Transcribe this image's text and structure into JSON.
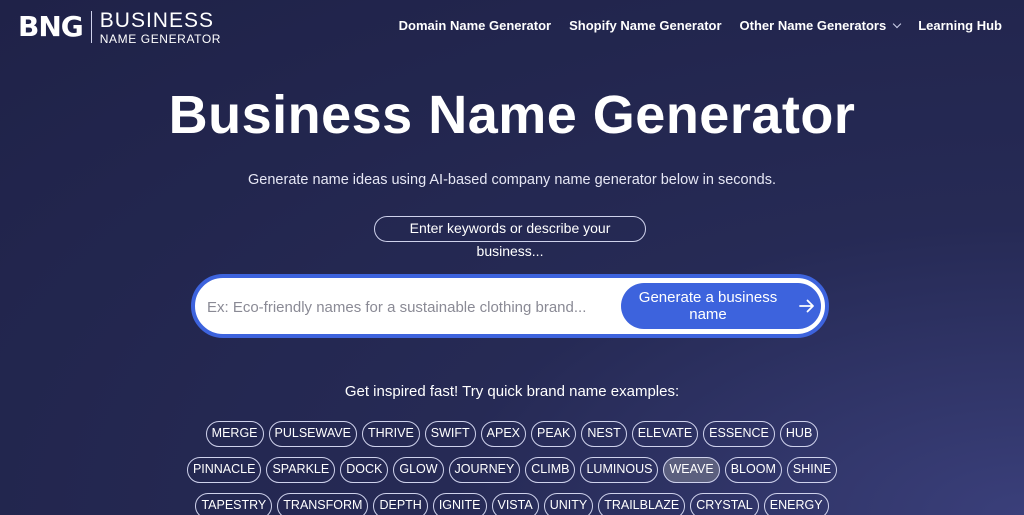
{
  "logo": {
    "mark": "BNG",
    "line1": "BUSINESS",
    "line2": "NAME GENERATOR"
  },
  "nav": {
    "items": [
      {
        "label": "Domain Name Generator"
      },
      {
        "label": "Shopify Name Generator"
      },
      {
        "label": "Other Name Generators",
        "dropdown": true
      },
      {
        "label": "Learning Hub"
      }
    ]
  },
  "hero": {
    "title": "Business Name Generator",
    "subtitle": "Generate name ideas using AI-based company name generator below in seconds."
  },
  "hint": "Enter keywords or describe your business...",
  "search": {
    "value": "",
    "placeholder": "Ex: Eco-friendly names for a sustainable clothing brand...",
    "button_label": "Generate a business name"
  },
  "inspire": "Get inspired fast! Try quick brand name examples:",
  "chips": [
    [
      "MERGE",
      "PULSEWAVE",
      "THRIVE",
      "SWIFT",
      "APEX",
      "PEAK",
      "NEST",
      "ELEVATE",
      "ESSENCE",
      "HUB"
    ],
    [
      "PINNACLE",
      "SPARKLE",
      "DOCK",
      "GLOW",
      "JOURNEY",
      "CLIMB",
      "LUMINOUS",
      "WEAVE",
      "BLOOM",
      "SHINE"
    ],
    [
      "TAPESTRY",
      "TRANSFORM",
      "DEPTH",
      "IGNITE",
      "VISTA",
      "UNITY",
      "TRAILBLAZE",
      "CRYSTAL",
      "ENERGY"
    ]
  ],
  "active_chip": "WEAVE",
  "colors": {
    "background": "#262a55",
    "accent": "#3d63dd",
    "chip_border": "#cfd2ec",
    "chip_active": "#5b5f7e"
  }
}
